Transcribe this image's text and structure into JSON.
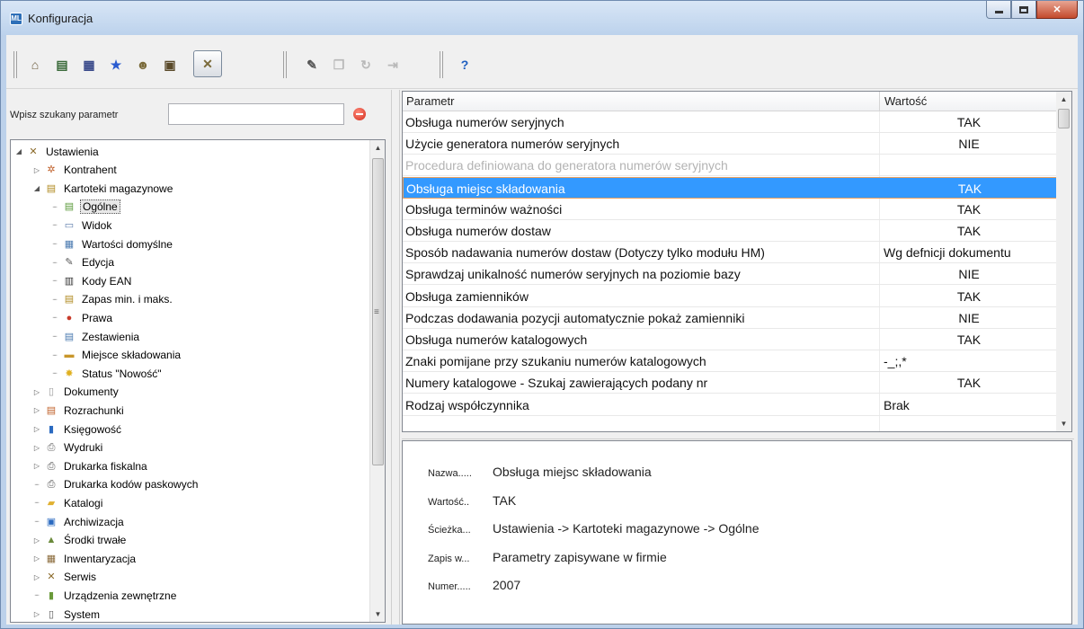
{
  "window": {
    "title": "Konfiguracja",
    "app_icon_text": "ML"
  },
  "toolbar": {
    "buttons": [
      {
        "name": "home-icon",
        "glyph": "⌂",
        "color": "#6a5a3a"
      },
      {
        "name": "settings-list-icon",
        "glyph": "▤",
        "color": "#3a6a3a"
      },
      {
        "name": "company-icon",
        "glyph": "▦",
        "color": "#3a4a8a"
      },
      {
        "name": "favorite-star-icon",
        "glyph": "★",
        "color": "#2a5bd0"
      },
      {
        "name": "users-icon",
        "glyph": "☻",
        "color": "#7a6a3a"
      },
      {
        "name": "warehouse-icon",
        "glyph": "▣",
        "color": "#5a4a2a"
      },
      {
        "name": "tools-icon",
        "glyph": "✕",
        "color": "#7a6a3a"
      },
      {
        "name": "edit-icon",
        "glyph": "✎",
        "color": "#555"
      },
      {
        "name": "copy-icon",
        "glyph": "❐",
        "color": "#777"
      },
      {
        "name": "refresh-icon",
        "glyph": "↻",
        "color": "#777"
      },
      {
        "name": "export-icon",
        "glyph": "⇥",
        "color": "#777"
      },
      {
        "name": "help-icon",
        "glyph": "?",
        "color": "#1f5fc0"
      }
    ]
  },
  "search": {
    "label": "Wpisz szukany parametr",
    "value": "",
    "placeholder": ""
  },
  "tree": {
    "items": [
      {
        "label": "Ustawienia",
        "level": 0,
        "expander": "◢",
        "icon": "tools-icon",
        "glyph": "✕",
        "color": "#8a6a2a"
      },
      {
        "label": "Kontrahent",
        "level": 1,
        "expander": "▷",
        "icon": "contractor-icon",
        "glyph": "✲",
        "color": "#c0602a"
      },
      {
        "label": "Kartoteki magazynowe",
        "level": 1,
        "expander": "◢",
        "icon": "warehouse-cards-icon",
        "glyph": "▤",
        "color": "#b08a20"
      },
      {
        "label": "Ogólne",
        "level": 2,
        "expander": "",
        "icon": "general-icon",
        "glyph": "▤",
        "color": "#5a9a3a",
        "selected": true
      },
      {
        "label": "Widok",
        "level": 2,
        "expander": "",
        "icon": "view-icon",
        "glyph": "▭",
        "color": "#5a7aaa"
      },
      {
        "label": "Wartości domyślne",
        "level": 2,
        "expander": "",
        "icon": "defaults-icon",
        "glyph": "▦",
        "color": "#4a7ab0"
      },
      {
        "label": "Edycja",
        "level": 2,
        "expander": "",
        "icon": "edit-icon",
        "glyph": "✎",
        "color": "#555"
      },
      {
        "label": "Kody EAN",
        "level": 2,
        "expander": "",
        "icon": "barcode-icon",
        "glyph": "▥",
        "color": "#333"
      },
      {
        "label": "Zapas min. i maks.",
        "level": 2,
        "expander": "",
        "icon": "stock-icon",
        "glyph": "▤",
        "color": "#b08a20"
      },
      {
        "label": "Prawa",
        "level": 2,
        "expander": "",
        "icon": "rights-icon",
        "glyph": "●",
        "color": "#c83a2a"
      },
      {
        "label": "Zestawienia",
        "level": 2,
        "expander": "",
        "icon": "report-icon",
        "glyph": "▤",
        "color": "#4a7ab0"
      },
      {
        "label": "Miejsce składowania",
        "level": 2,
        "expander": "",
        "icon": "storage-location-icon",
        "glyph": "▬",
        "color": "#c8962a"
      },
      {
        "label": "Status \"Nowość\"",
        "level": 2,
        "expander": "",
        "icon": "new-status-icon",
        "glyph": "✸",
        "color": "#e0b020"
      },
      {
        "label": "Dokumenty",
        "level": 1,
        "expander": "▷",
        "icon": "documents-icon",
        "glyph": "▯",
        "color": "#999"
      },
      {
        "label": "Rozrachunki",
        "level": 1,
        "expander": "▷",
        "icon": "settlements-icon",
        "glyph": "▤",
        "color": "#c0602a"
      },
      {
        "label": "Księgowość",
        "level": 1,
        "expander": "▷",
        "icon": "accounting-icon",
        "glyph": "▮",
        "color": "#2a6ac0"
      },
      {
        "label": "Wydruki",
        "level": 1,
        "expander": "▷",
        "icon": "printouts-icon",
        "glyph": "⎙",
        "color": "#666"
      },
      {
        "label": "Drukarka fiskalna",
        "level": 1,
        "expander": "▷",
        "icon": "fiscal-printer-icon",
        "glyph": "⎙",
        "color": "#555"
      },
      {
        "label": "Drukarka kodów paskowych",
        "level": 1,
        "expander": "",
        "icon": "barcode-printer-icon",
        "glyph": "⎙",
        "color": "#555"
      },
      {
        "label": "Katalogi",
        "level": 1,
        "expander": "",
        "icon": "folder-icon",
        "glyph": "▰",
        "color": "#e0b030"
      },
      {
        "label": "Archiwizacja",
        "level": 1,
        "expander": "",
        "icon": "archive-icon",
        "glyph": "▣",
        "color": "#2a6ac0"
      },
      {
        "label": "Środki trwałe",
        "level": 1,
        "expander": "▷",
        "icon": "fixed-assets-icon",
        "glyph": "▲",
        "color": "#6a8a3a"
      },
      {
        "label": "Inwentaryzacja",
        "level": 1,
        "expander": "▷",
        "icon": "inventory-icon",
        "glyph": "▦",
        "color": "#8a6a3a"
      },
      {
        "label": "Serwis",
        "level": 1,
        "expander": "▷",
        "icon": "service-icon",
        "glyph": "✕",
        "color": "#8a6a2a"
      },
      {
        "label": "Urządzenia zewnętrzne",
        "level": 1,
        "expander": "",
        "icon": "external-devices-icon",
        "glyph": "▮",
        "color": "#6a9a3a"
      },
      {
        "label": "System",
        "level": 1,
        "expander": "▷",
        "icon": "system-icon",
        "glyph": "▯",
        "color": "#555"
      }
    ]
  },
  "grid": {
    "headers": {
      "param": "Parametr",
      "value": "Wartość"
    },
    "rows": [
      {
        "name": "Obsługa numerów seryjnych",
        "value": "TAK",
        "align": "center"
      },
      {
        "name": "Użycie generatora numerów seryjnych",
        "value": "NIE",
        "align": "center"
      },
      {
        "name": "Procedura definiowana do generatora numerów seryjnych",
        "value": "",
        "align": "center",
        "disabled": true
      },
      {
        "name": "Obsługa miejsc składowania",
        "value": "TAK",
        "align": "center",
        "selected": true
      },
      {
        "name": "Obsługa terminów ważności",
        "value": "TAK",
        "align": "center"
      },
      {
        "name": "Obsługa numerów dostaw",
        "value": "TAK",
        "align": "center"
      },
      {
        "name": "Sposób nadawania numerów dostaw (Dotyczy tylko modułu HM)",
        "value": "Wg defnicji dokumentu",
        "align": "left"
      },
      {
        "name": "Sprawdzaj unikalność numerów seryjnych na poziomie bazy",
        "value": "NIE",
        "align": "center"
      },
      {
        "name": "Obsługa zamienników",
        "value": "TAK",
        "align": "center"
      },
      {
        "name": "Podczas dodawania pozycji automatycznie pokaż zamienniki",
        "value": "NIE",
        "align": "center"
      },
      {
        "name": "Obsługa numerów katalogowych",
        "value": "TAK",
        "align": "center"
      },
      {
        "name": "Znaki pomijane przy szukaniu numerów katalogowych",
        "value": "-_;,*",
        "align": "left"
      },
      {
        "name": "Numery katalogowe - Szukaj zawierających podany nr",
        "value": "TAK",
        "align": "center"
      },
      {
        "name": "Rodzaj współczynnika",
        "value": "Brak",
        "align": "left"
      }
    ]
  },
  "details": {
    "rows": [
      {
        "label": "Nazwa.....",
        "value": "Obsługa miejsc składowania"
      },
      {
        "label": "Wartość..",
        "value": "TAK"
      },
      {
        "label": "Ścieżka...",
        "value": "Ustawienia -> Kartoteki magazynowe -> Ogólne"
      },
      {
        "label": "Zapis w...",
        "value": "Parametry zapisywane w firmie"
      },
      {
        "label": "Numer.....",
        "value": "2007"
      }
    ]
  },
  "colors": {
    "selection": "#3399ff",
    "selection_border": "#e8a060",
    "disabled_text": "#b3b3b3"
  }
}
